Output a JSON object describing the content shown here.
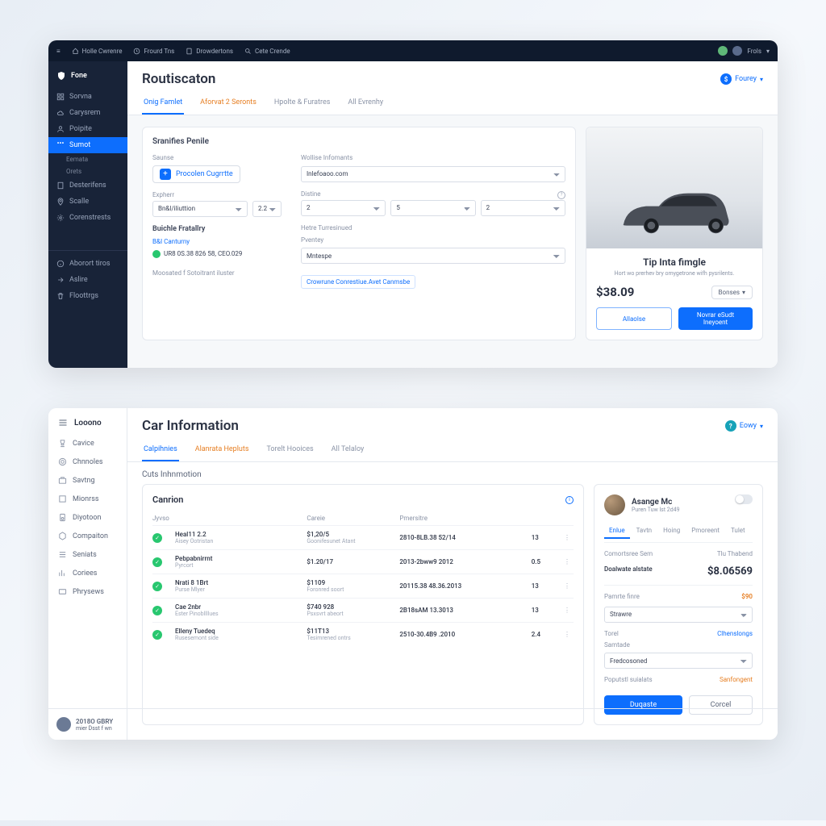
{
  "top": {
    "topbar": {
      "menu": "≡",
      "items": [
        "Holle Cwrenre",
        "Frourd Tns",
        "Drowdertons",
        "Cete Crende"
      ],
      "user": "Frols"
    },
    "sidebar": {
      "logo": "Fone",
      "items": [
        "Sorvna",
        "Carysrem",
        "Poipite"
      ],
      "active": "Sumot",
      "subs": [
        "Eemata",
        "Orets"
      ],
      "items2": [
        "Desterifens",
        "Scalle",
        "Corenstrests"
      ],
      "footer": [
        "Aborort tiros",
        "Aslire",
        "Floottrgs"
      ]
    },
    "header": {
      "title": "Routiscaton",
      "action": "Fourey"
    },
    "tabs": [
      "Onig Famlet",
      "Aforvat 2 Seronts",
      "Hpolte & Furatres",
      "All Evrenhy"
    ],
    "card": {
      "title": "Sranifies Penile",
      "left": {
        "source_label": "Saunse",
        "source_btn": "Procolen Cugrrtte",
        "depart_label": "Expherr",
        "depart_val": "Bn&l/iliuttion",
        "num1": "2.2",
        "history_label": "Buichle Fratallry",
        "history_link": "B&I Canturny",
        "history_val": "UR8 0S.38 826 58, CEO.029",
        "footer_text": "Moosated f Sotoitrant iluster"
      },
      "right": {
        "website_label": "Wollise Infomants",
        "website_val": "Inlefoaoo.com",
        "destiny_label": "Distine",
        "num2": "2",
        "num3": "5",
        "num4": "2",
        "hint": "Hetre Turresinued",
        "priority_label": "Pventey",
        "priority_val": "Mntespe",
        "link": "Crowrune Conrestiue.Avet Canmsbe"
      }
    },
    "side": {
      "title": "Tip Inta fimgle",
      "sub": "Hort wo prerhev bry omygetrone wifh pysrilents.",
      "price": "$38.09",
      "opt_btn": "Bonses",
      "btn1": "Allaolse",
      "btn2": "Novrar eSudt Ineyoent"
    }
  },
  "bottom": {
    "brand": "Looono",
    "sidebar": [
      "Cavice",
      "Chnnoles",
      "Savtng",
      "Mionrss",
      "Diyotoon",
      "Compaiton",
      "Seniats",
      "Coriees",
      "Phrysews"
    ],
    "user": {
      "name": "2018O GBRY",
      "sub": "mier Dsst f wn"
    },
    "header": {
      "title": "Car Information",
      "action": "Eowy"
    },
    "tabs": [
      "Calpihnies",
      "Alanrata Hepluts",
      "Torelt Hooices",
      "All Telaloy"
    ],
    "section": "Cuts Inhnmotion",
    "table": {
      "title": "Canrion",
      "cols": [
        "Jyvso",
        "",
        "Careie",
        "Pmersitre",
        "",
        ""
      ],
      "rows": [
        {
          "name": "Heal11 2.2",
          "sub": "Aisey Ootristan",
          "price": "$1,20/5",
          "psub": "Goonifesunet Atant",
          "date": "2810-8LB.38 52/14",
          "n": "13"
        },
        {
          "name": "Pebpabnirrnt",
          "sub": "Pyrcort",
          "price": "$1.20/17",
          "psub": "",
          "date": "2013-2bww9 2012",
          "n": "0.5"
        },
        {
          "name": "Nrati 8 1Brt",
          "sub": "Purse Mlyer",
          "price": "$1109",
          "psub": "Foronred soort",
          "date": "20115.38 48.36.2013",
          "n": "13"
        },
        {
          "name": "Cae 2nbr",
          "sub": "Ester Pinobllllues",
          "price": "$740 928",
          "psub": "Psxsvrt abeort",
          "date": "2B18sAM 13.3013",
          "n": "13"
        },
        {
          "name": "Elleny Tuedeq",
          "sub": "Rusesemont side",
          "price": "$11T13",
          "psub": "Tesimrened ontrs",
          "date": "2510-30.4B9 .2010",
          "n": "2.4"
        }
      ]
    },
    "profile": {
      "name": "Asange Mc",
      "sub": "Puren Tuw lst 2d49",
      "chips": [
        "Enlue",
        "Tavtn",
        "Hoing",
        "Pmoreent",
        "Tulet"
      ],
      "r1l": "Comortsree Sem",
      "r1r": "Tlu Thabend",
      "r2l": "Doalwate alstate",
      "r2r": "$8.06569",
      "r3l": "Pamrte finre",
      "r3r": "$90",
      "sel1_label": "Strawre",
      "r4l": "Torel",
      "r4r": "Clhenslongs",
      "sel2_label": "Samtade",
      "sel2_val": "Fredcosoned",
      "r5l": "Poputstl suialats",
      "r5r": "Sanfongent",
      "btn1": "Duqaste",
      "btn2": "Corcel"
    }
  }
}
